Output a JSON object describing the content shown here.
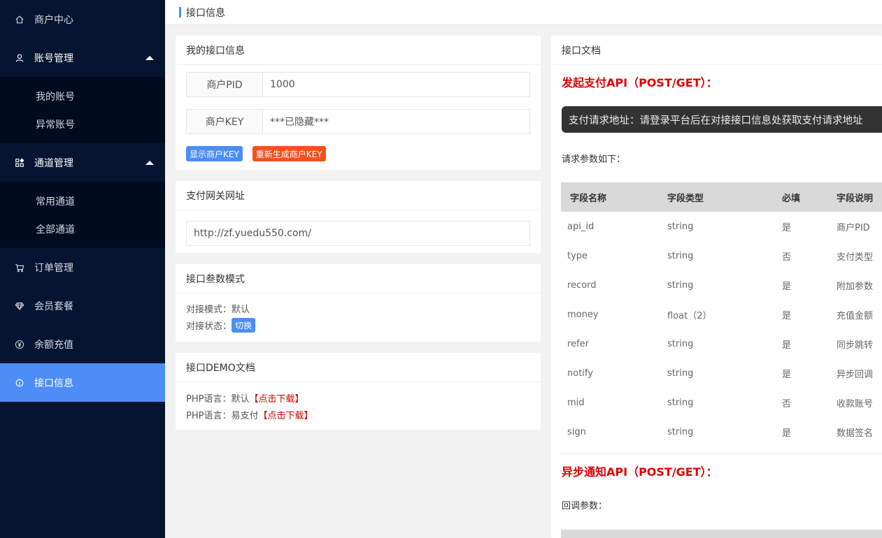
{
  "sidebar": {
    "merchant_center": "商户中心",
    "account_mgmt": "账号管理",
    "account_sub": [
      "我的账号",
      "异常账号"
    ],
    "channel_mgmt": "通道管理",
    "channel_sub": [
      "常用通道",
      "全部通道"
    ],
    "order_mgmt": "订单管理",
    "member_plan": "会员套餐",
    "balance_recharge": "余额充值",
    "api_info": "接口信息"
  },
  "header": {
    "title": "接口信息"
  },
  "my_api": {
    "title": "我的接口信息",
    "pid_label": "商户PID",
    "pid_value": "1000",
    "key_label": "商户KEY",
    "key_value": "***已隐藏***",
    "show_key_btn": "显示商户KEY",
    "regen_key_btn": "重新生成商户KEY"
  },
  "gateway": {
    "title": "支付网关网址",
    "url": "http://zf.yuedu550.com/"
  },
  "param_mode": {
    "title": "接口叁数模式",
    "mode_line": "对接模式：默认",
    "status_label": "对接状态：",
    "switch_btn": "切换"
  },
  "demo": {
    "title": "接口DEMO文档",
    "line1_prefix": "PHP语言：默认",
    "line1_link": "【点击下载】",
    "line2_prefix": "PHP语言：易支付",
    "line2_link": "【点击下载】"
  },
  "docs": {
    "title": "接口文档",
    "pay_api_heading": "发起支付API（POST/GET）：",
    "pay_url_note": "支付请求地址：请登录平台后在对接接口信息处获取支付请求地址",
    "req_params_label": "请求参数如下：",
    "columns": [
      "字段名称",
      "字段类型",
      "必填",
      "字段说明"
    ],
    "rows": [
      [
        "api_id",
        "string",
        "是",
        "商户PID"
      ],
      [
        "type",
        "string",
        "否",
        "支付类型"
      ],
      [
        "record",
        "string",
        "是",
        "附加参数"
      ],
      [
        "money",
        "float（2）",
        "是",
        "充值金额"
      ],
      [
        "refer",
        "string",
        "是",
        "同步跳转"
      ],
      [
        "notify",
        "string",
        "是",
        "异步回调"
      ],
      [
        "mid",
        "string",
        "否",
        "收款账号"
      ],
      [
        "sign",
        "string",
        "是",
        "数据签名"
      ]
    ],
    "notify_api_heading": "异步通知API（POST/GET）：",
    "callback_label": "回调参数："
  }
}
